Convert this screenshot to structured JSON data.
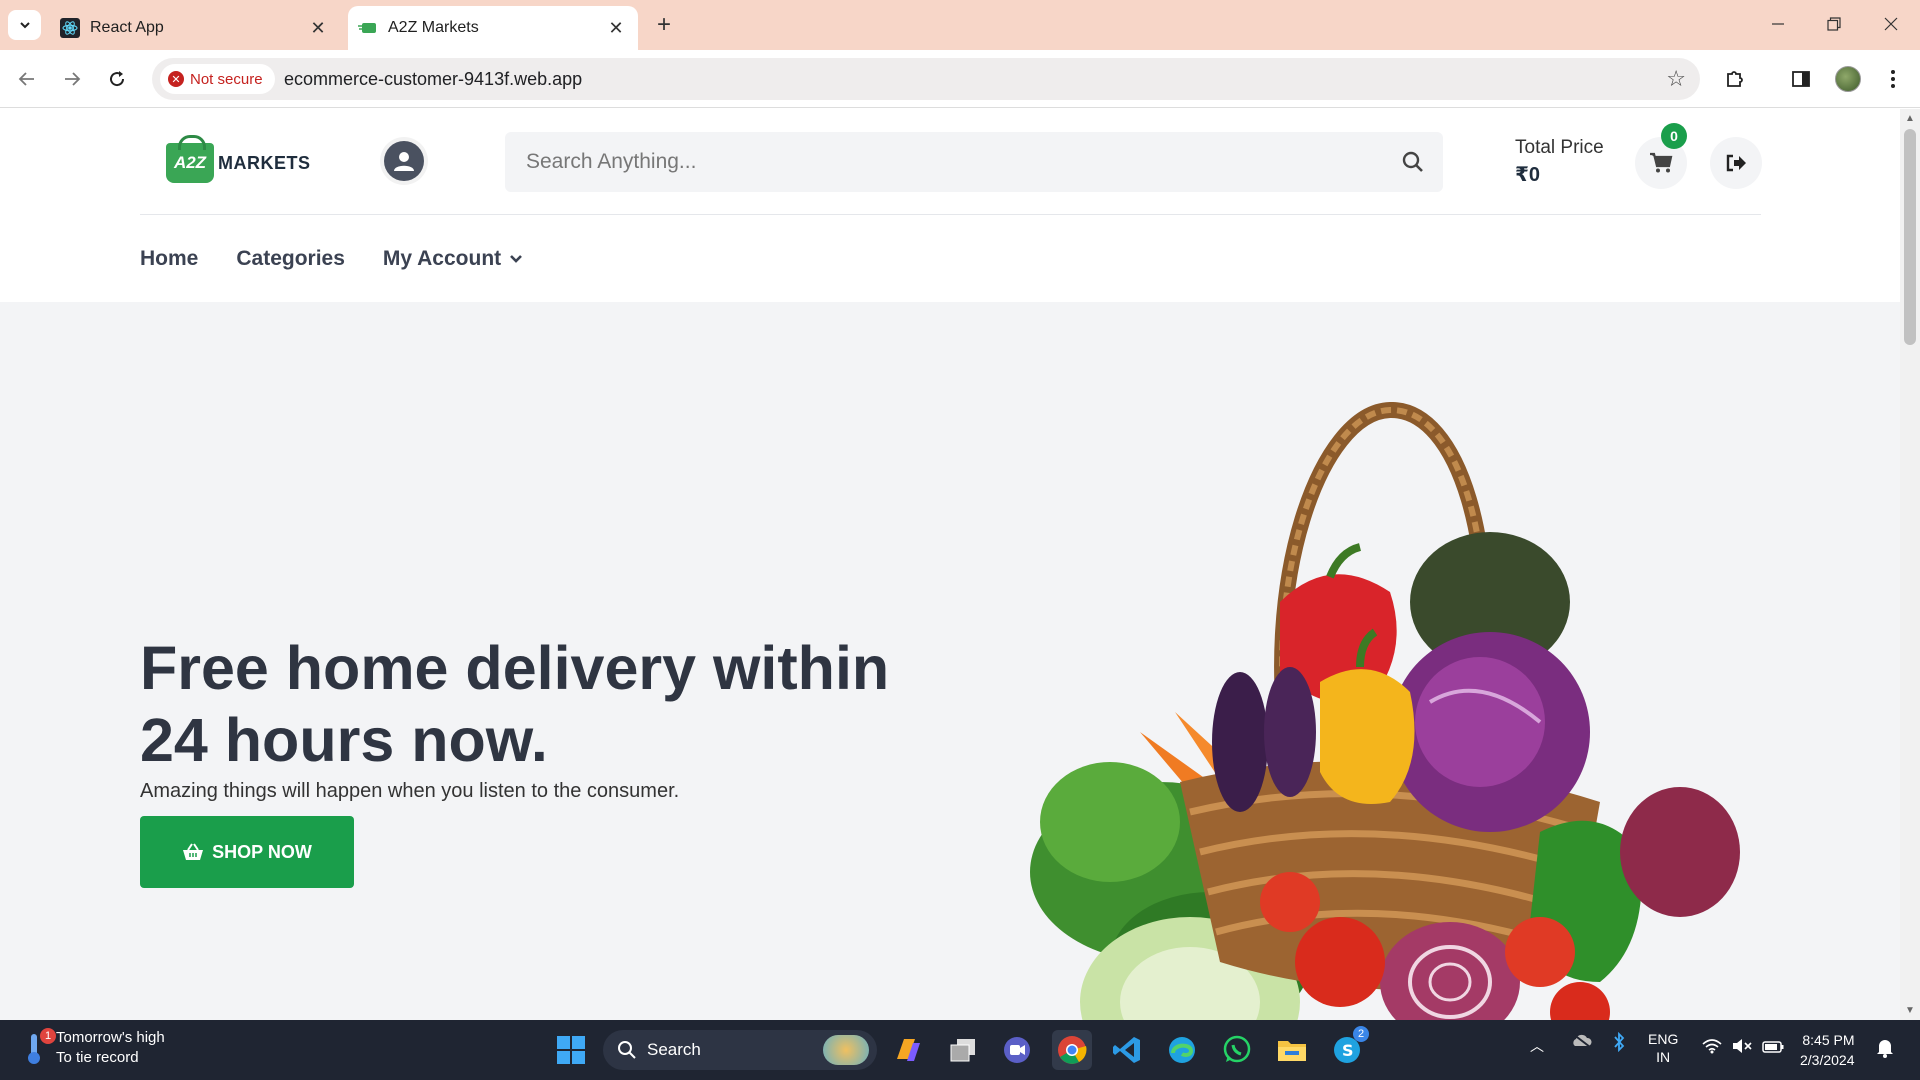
{
  "browser": {
    "tabs": [
      {
        "title": "React App"
      },
      {
        "title": "A2Z Markets"
      }
    ],
    "security_label": "Not secure",
    "url": "ecommerce-customer-9413f.web.app"
  },
  "site": {
    "logo_badge": "A2Z",
    "logo_text": "MARKETS",
    "search_placeholder": "Search Anything...",
    "total_price_label": "Total Price",
    "total_price_value": "₹0",
    "cart_count": "0",
    "nav": {
      "home": "Home",
      "categories": "Categories",
      "my_account": "My Account"
    }
  },
  "hero": {
    "title": "Free home delivery within 24 hours now.",
    "subtitle": "Amazing things will happen when you listen to the consumer.",
    "cta": "SHOP NOW"
  },
  "taskbar": {
    "weather_line1": "Tomorrow's high",
    "weather_line2": "To tie record",
    "weather_badge": "1",
    "search_label": "Search",
    "skype_badge": "2",
    "lang_line1": "ENG",
    "lang_line2": "IN",
    "time": "8:45 PM",
    "date": "2/3/2024"
  },
  "colors": {
    "brand_green": "#1a9e4b",
    "tab_strip": "#f7d6c8",
    "hero_bg": "#f3f4f6",
    "text_dark": "#2f3542",
    "taskbar": "#1f2532"
  }
}
